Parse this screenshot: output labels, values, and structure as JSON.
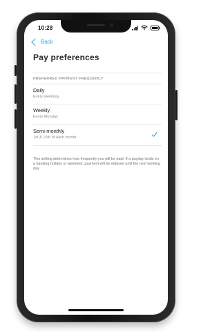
{
  "status_bar": {
    "time": "10:28"
  },
  "nav": {
    "back_label": "Back"
  },
  "header": {
    "title": "Pay preferences"
  },
  "section": {
    "header": "PREFERRED PAYMENT FREQUENCY"
  },
  "options": [
    {
      "title": "Daily",
      "subtitle": "Every weekday",
      "selected": false
    },
    {
      "title": "Weekly",
      "subtitle": "Every Monday",
      "selected": false
    },
    {
      "title": "Semi-monthly",
      "subtitle": "1st & 15th of each month",
      "selected": true
    }
  ],
  "footnote": "This setting determines how frequently you will be paid. If a payday lands on a banking holiday or weekend, payment will be delayed until the next working day.",
  "colors": {
    "accent": "#2aa7d6",
    "title_text": "#2a2a2a",
    "secondary_text": "#8b8b8b",
    "divider": "#e8e8e8"
  },
  "icons": {
    "back": "chevron-left-icon",
    "selected": "checkmark-icon",
    "status": [
      "signal-icon",
      "wifi-icon",
      "battery-icon"
    ]
  }
}
